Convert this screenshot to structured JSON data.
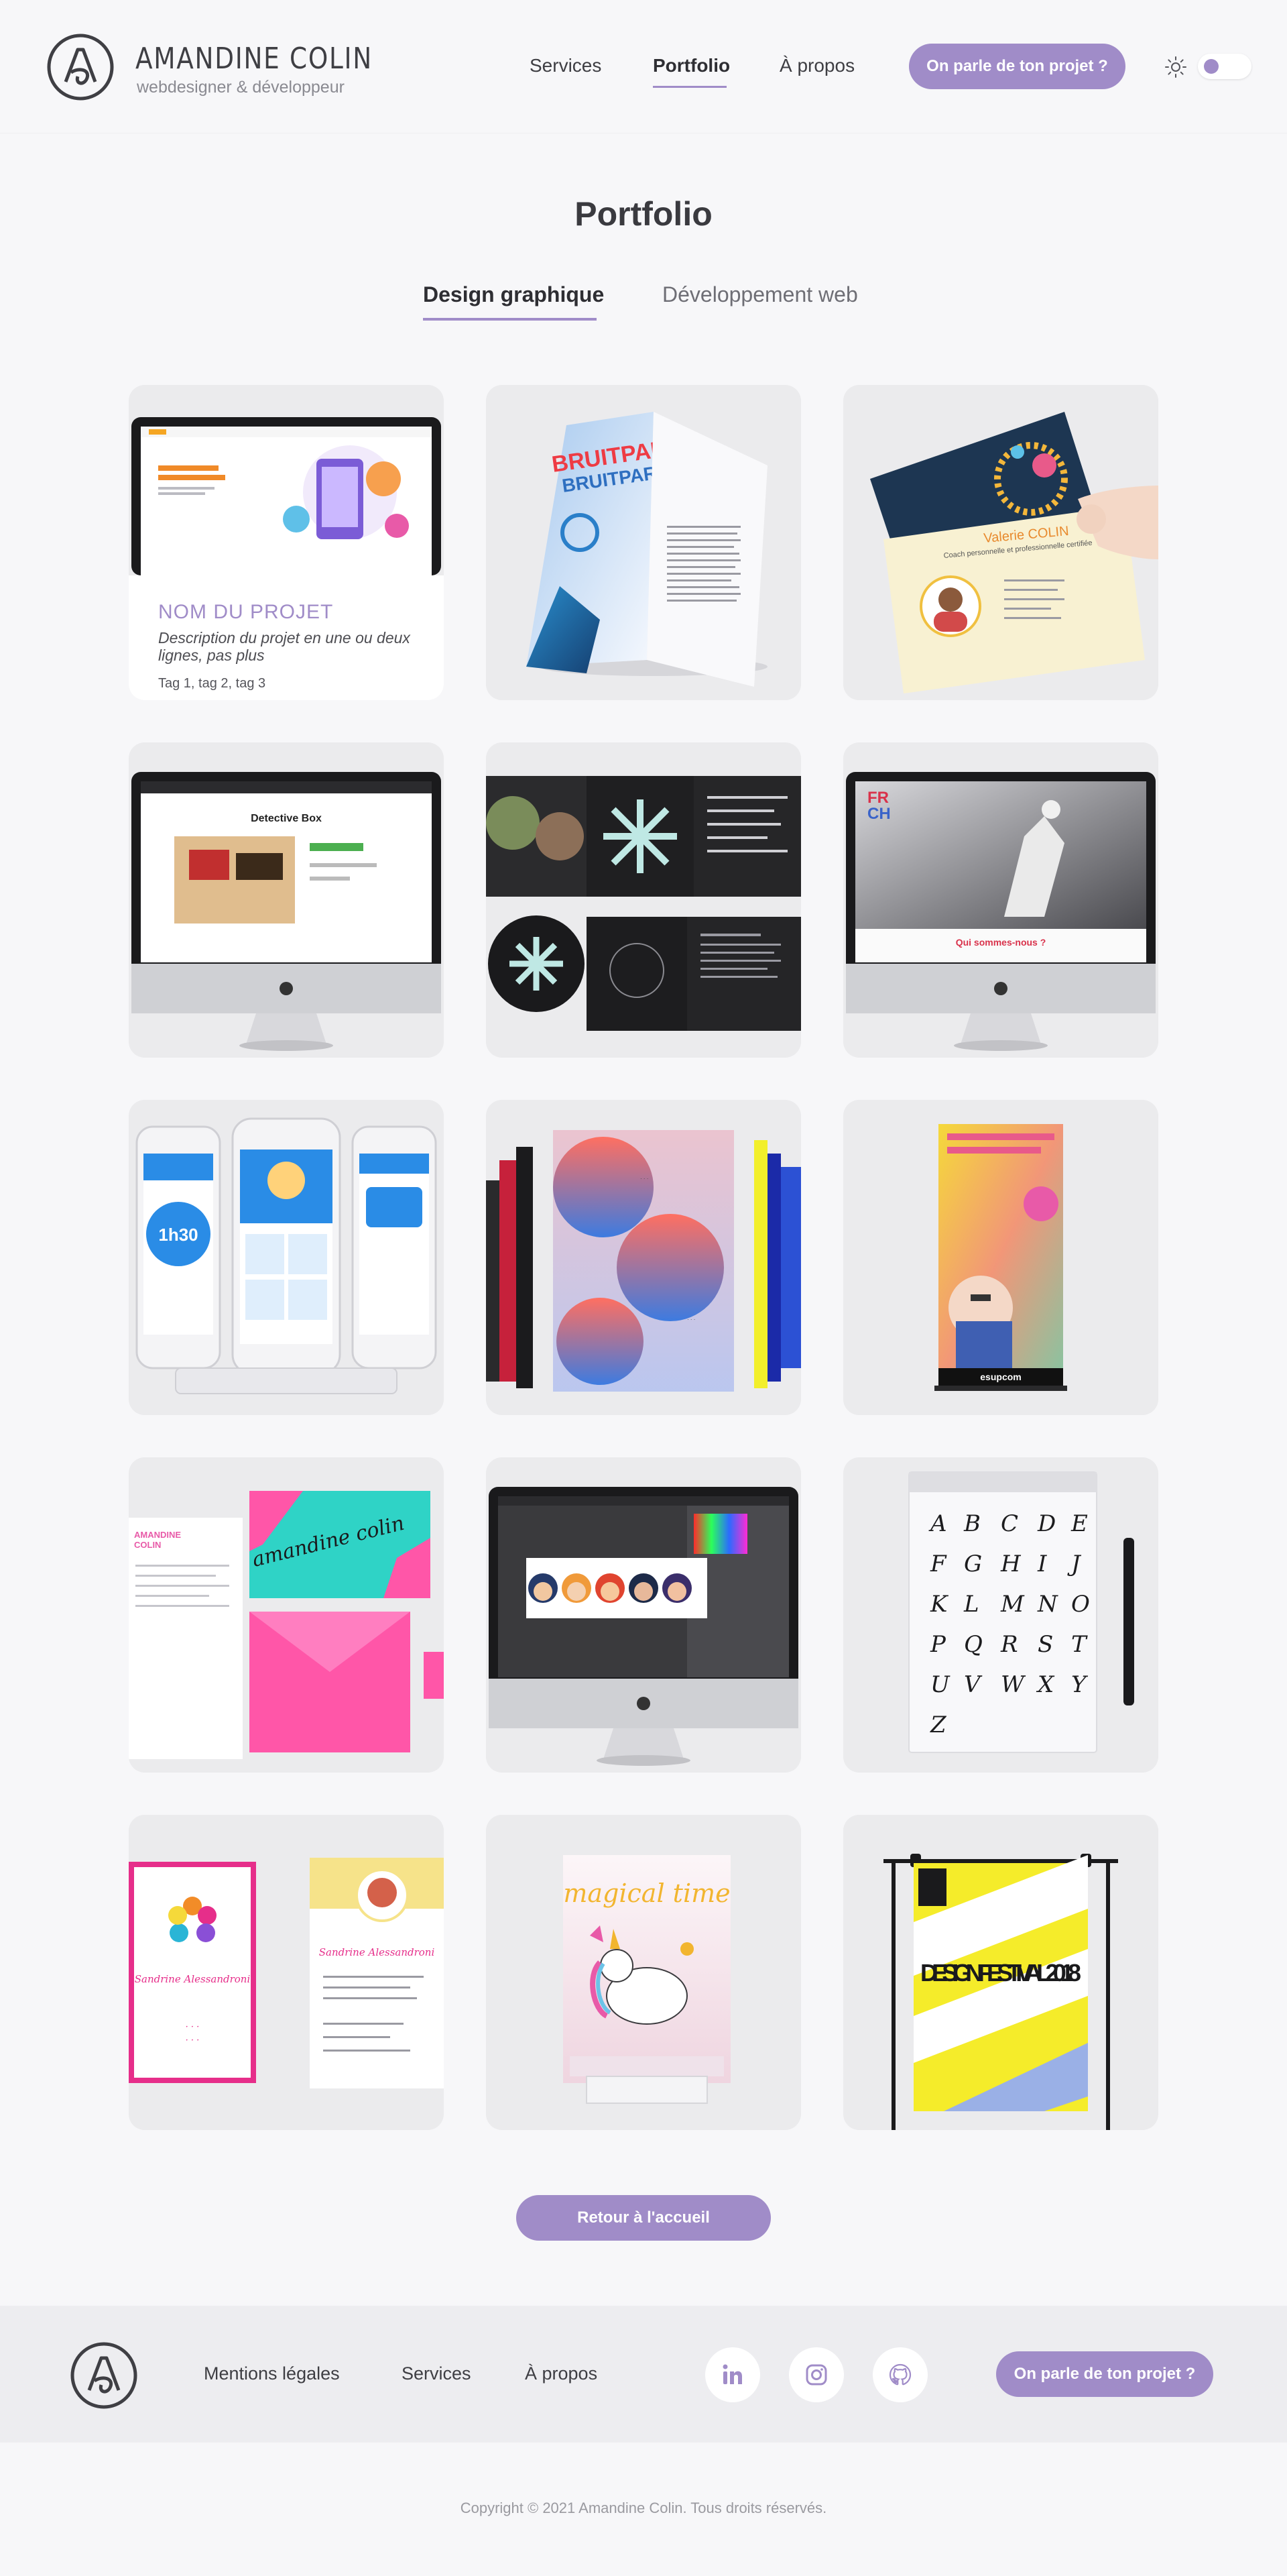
{
  "header": {
    "brand_name": "AMANDINE COLIN",
    "brand_tagline": "webdesigner & développeur",
    "nav": [
      "Services",
      "Portfolio",
      "À propos"
    ],
    "active_nav": "Portfolio",
    "cta_label": "On parle de ton projet ?",
    "theme_toggle": "light"
  },
  "main": {
    "title": "Portfolio",
    "tabs": [
      {
        "label": "Design graphique",
        "active": true
      },
      {
        "label": "Développement web",
        "active": false
      }
    ],
    "projects": [
      {
        "image": "laptop-website-mockup",
        "hovered": true,
        "name": "NOM DU PROJET",
        "description": "Description du projet en une ou deux lignes, pas plus",
        "tags": "Tag 1, tag 2, tag 3"
      },
      {
        "image": "brochure-bruitparif",
        "texts": [
          "BRUITPARIF"
        ]
      },
      {
        "image": "business-card-valerie-colin",
        "texts": [
          "Valerie COLIN",
          "Coach personnelle et professionnelle certifiée"
        ]
      },
      {
        "image": "imac-detective-box",
        "texts": [
          "Detective Box"
        ]
      },
      {
        "image": "album-booklet-dark"
      },
      {
        "image": "imac-qui-sommes-nous",
        "texts": [
          "Qui sommes-nous ?"
        ]
      },
      {
        "image": "three-phones-app"
      },
      {
        "image": "gradient-posters-stack"
      },
      {
        "image": "rollup-banner-esupcom",
        "texts": [
          "esupcom"
        ]
      },
      {
        "image": "stationery-amandine-colin",
        "texts": [
          "amandine colin"
        ]
      },
      {
        "image": "imac-illustrator-avatars"
      },
      {
        "image": "notebook-letter-sketches"
      },
      {
        "image": "cards-sandrine-alessandroni",
        "texts": [
          "Sandrine Alessandroni"
        ]
      },
      {
        "image": "poster-magical-time",
        "texts": [
          "magical time"
        ]
      },
      {
        "image": "poster-design-festival",
        "texts": [
          "DESIGN FESTIVAL 2018"
        ]
      }
    ],
    "back_button": "Retour à l'accueil"
  },
  "footer": {
    "links": [
      "Mentions légales",
      "Services",
      "À propos"
    ],
    "social": [
      "linkedin-icon",
      "instagram-icon",
      "github-icon"
    ],
    "cta_label": "On parle de ton projet ?",
    "copyright": "Copyright © 2021 Amandine Colin. Tous droits réservés."
  },
  "colors": {
    "accent": "#a08cc8",
    "background": "#f7f7f9",
    "card": "#ebebed",
    "text": "#3b3b3f"
  }
}
